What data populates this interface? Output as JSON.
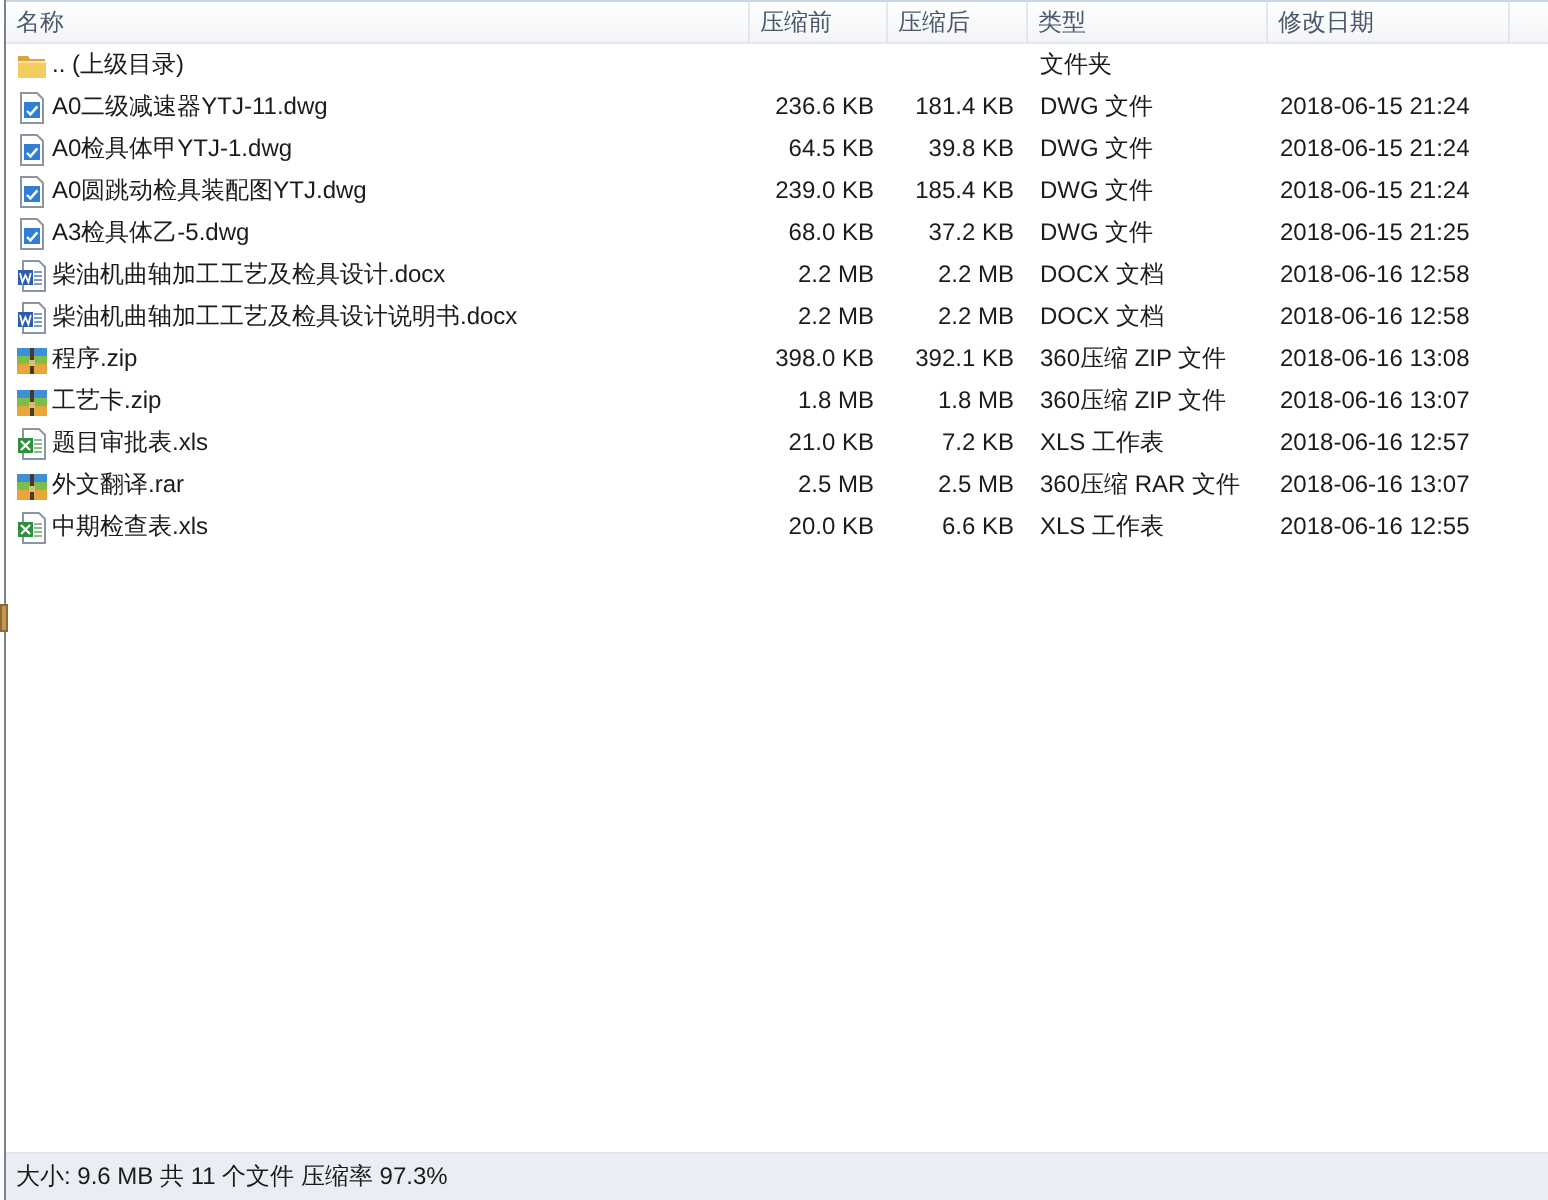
{
  "columns": [
    "名称",
    "压缩前",
    "压缩后",
    "类型",
    "修改日期"
  ],
  "rows": [
    {
      "kind": "folder",
      "name": ".. (上级目录)",
      "type": "文件夹"
    },
    {
      "kind": "dwg",
      "name": "A0二级减速器YTJ-11.dwg",
      "original_size": "236.6 KB",
      "compressed_size": "181.4 KB",
      "type": "DWG 文件",
      "modified": "2018-06-15 21:24"
    },
    {
      "kind": "dwg",
      "name": "A0检具体甲YTJ-1.dwg",
      "original_size": "64.5 KB",
      "compressed_size": "39.8 KB",
      "type": "DWG 文件",
      "modified": "2018-06-15 21:24"
    },
    {
      "kind": "dwg",
      "name": "A0圆跳动检具装配图YTJ.dwg",
      "original_size": "239.0 KB",
      "compressed_size": "185.4 KB",
      "type": "DWG 文件",
      "modified": "2018-06-15 21:24"
    },
    {
      "kind": "dwg",
      "name": "A3检具体乙-5.dwg",
      "original_size": "68.0 KB",
      "compressed_size": "37.2 KB",
      "type": "DWG 文件",
      "modified": "2018-06-15 21:25"
    },
    {
      "kind": "docx",
      "name": "柴油机曲轴加工工艺及检具设计.docx",
      "original_size": "2.2 MB",
      "compressed_size": "2.2 MB",
      "type": "DOCX 文档",
      "modified": "2018-06-16 12:58"
    },
    {
      "kind": "docx",
      "name": "柴油机曲轴加工工艺及检具设计说明书.docx",
      "original_size": "2.2 MB",
      "compressed_size": "2.2 MB",
      "type": "DOCX 文档",
      "modified": "2018-06-16 12:58"
    },
    {
      "kind": "archive",
      "name": "程序.zip",
      "original_size": "398.0 KB",
      "compressed_size": "392.1 KB",
      "type": "360压缩 ZIP 文件",
      "modified": "2018-06-16 13:08"
    },
    {
      "kind": "archive",
      "name": "工艺卡.zip",
      "original_size": "1.8 MB",
      "compressed_size": "1.8 MB",
      "type": "360压缩 ZIP 文件",
      "modified": "2018-06-16 13:07"
    },
    {
      "kind": "xls",
      "name": "题目审批表.xls",
      "original_size": "21.0 KB",
      "compressed_size": "7.2 KB",
      "type": "XLS 工作表",
      "modified": "2018-06-16 12:57"
    },
    {
      "kind": "archive",
      "name": "外文翻译.rar",
      "original_size": "2.5 MB",
      "compressed_size": "2.5 MB",
      "type": "360压缩 RAR 文件",
      "modified": "2018-06-16 13:07"
    },
    {
      "kind": "xls",
      "name": "中期检查表.xls",
      "original_size": "20.0 KB",
      "compressed_size": "6.6 KB",
      "type": "XLS 工作表",
      "modified": "2018-06-16 12:55"
    }
  ],
  "status_bar": {
    "text": "大小: 9.6 MB 共 11 个文件 压缩率 97.3%"
  }
}
